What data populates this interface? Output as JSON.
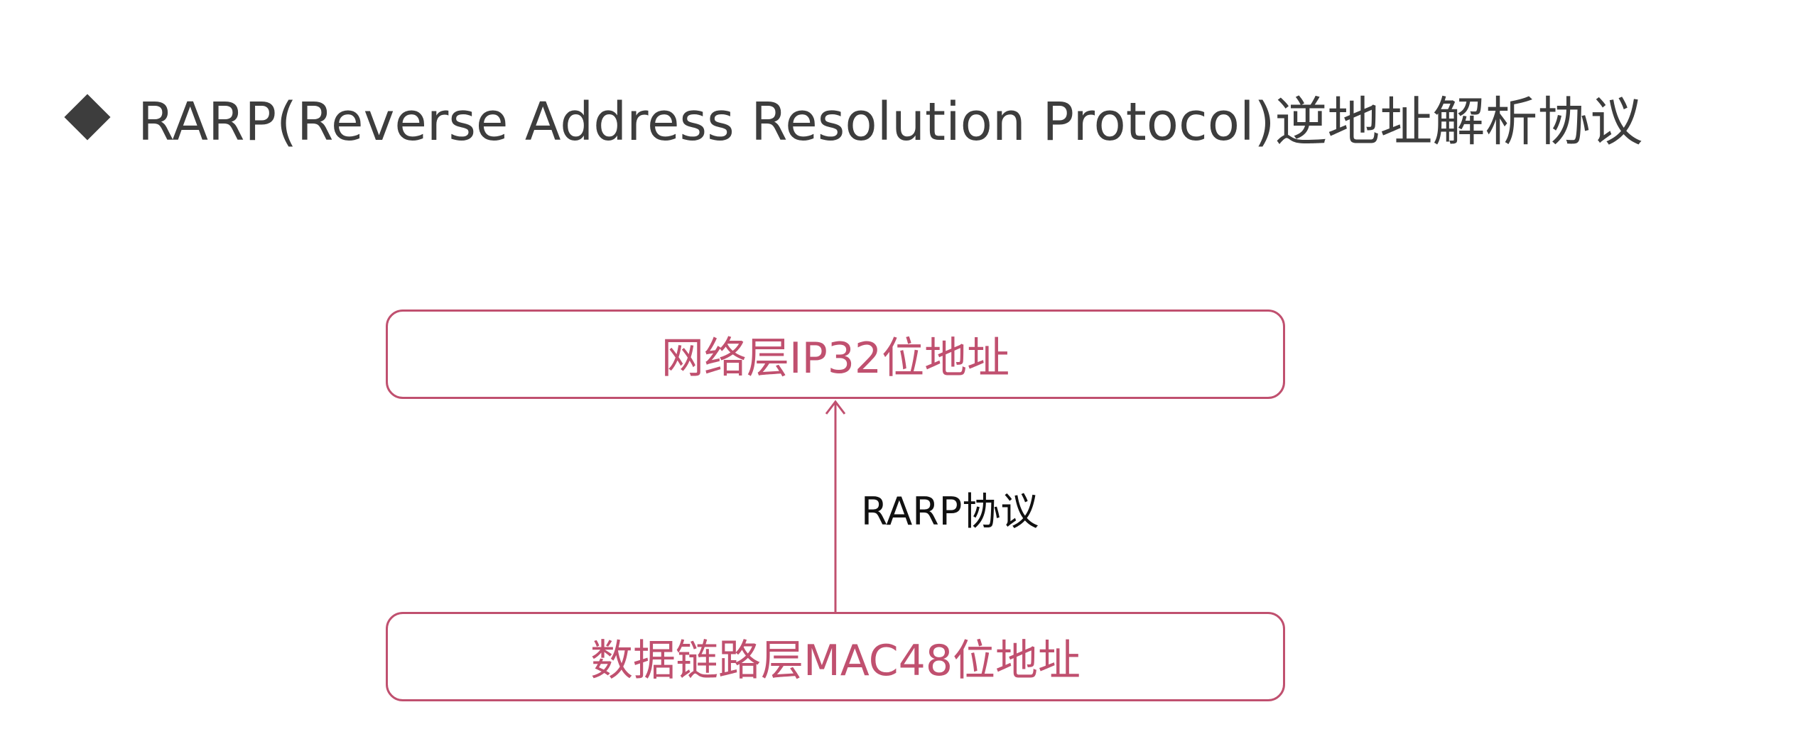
{
  "heading": {
    "text": "RARP(Reverse Address Resolution Protocol)逆地址解析协议",
    "bullet_icon": "diamond-bullet-icon"
  },
  "diagram": {
    "top_node": {
      "label": "网络层IP32位地址"
    },
    "bottom_node": {
      "label": "数据链路层MAC48位地址"
    },
    "edge": {
      "label": "RARP协议",
      "direction": "bottom-to-top"
    }
  },
  "colors": {
    "heading_text": "#3d3d3d",
    "accent": "#c0506f",
    "edge_label": "#111111",
    "background": "#ffffff"
  }
}
